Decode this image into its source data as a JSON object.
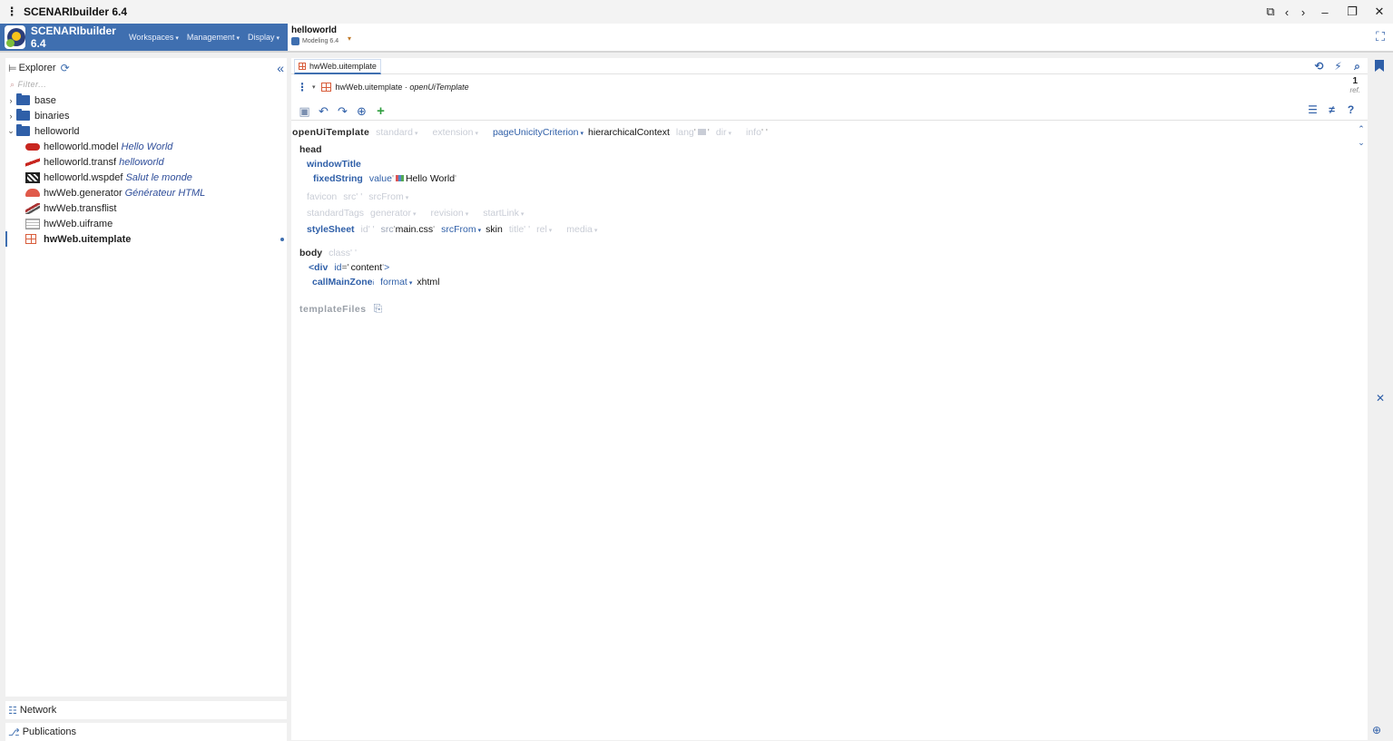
{
  "window": {
    "title": "SCENARIbuilder 6.4",
    "menu_glyph": "⋮"
  },
  "header": {
    "brand": "SCENARIbuilder 6.4",
    "menus": [
      "Workspaces",
      "Management",
      "Display"
    ],
    "workspace": {
      "name": "helloworld",
      "model": "Modeling 6.4"
    }
  },
  "explorer": {
    "title": "Explorer",
    "filter_placeholder": "Filter...",
    "tree": [
      {
        "label": "base",
        "kind": "folder",
        "expanded": false
      },
      {
        "label": "binaries",
        "kind": "folder",
        "expanded": false
      },
      {
        "label": "helloworld",
        "kind": "folder",
        "expanded": true
      },
      {
        "label": "helloworld.model",
        "desc": "Hello World",
        "icon": "model-icon"
      },
      {
        "label": "helloworld.transf",
        "desc": "helloworld",
        "icon": "transf-icon"
      },
      {
        "label": "helloworld.wspdef",
        "desc": "Salut le monde",
        "icon": "wspdef-icon"
      },
      {
        "label": "hwWeb.generator",
        "desc": "Générateur HTML",
        "icon": "generator-icon"
      },
      {
        "label": "hwWeb.transflist",
        "desc": "",
        "icon": "transflist-icon"
      },
      {
        "label": "hwWeb.uiframe",
        "desc": "",
        "icon": "uiframe-icon"
      },
      {
        "label": "hwWeb.uitemplate",
        "desc": "",
        "icon": "uitemplate-icon",
        "selected": true
      }
    ]
  },
  "panels": {
    "network": "Network",
    "publications": "Publications"
  },
  "editor": {
    "tab_label": "hwWeb.uitemplate",
    "breadcrumb_file": "hwWeb.uitemplate",
    "breadcrumb_sep": " · ",
    "breadcrumb_model": "openUiTemplate",
    "ref_count": "1",
    "ref_label": "ref.",
    "content": {
      "root": "openUiTemplate",
      "root_attrs": {
        "standard": "standard",
        "extension": "extension",
        "criterion": "pageUnicityCriterion",
        "criterion_value": "hierarchicalContext",
        "lang": "lang",
        "dir": "dir",
        "info": "info"
      },
      "head": "head",
      "windowTitle": "windowTitle",
      "fixedString": "fixedString",
      "value_label": "value",
      "value_text": "Hello World",
      "favicon": "favicon",
      "src_label": "src",
      "srcFrom_label": "srcFrom",
      "standardTags": "standardTags",
      "generator_label": "generator",
      "revision_label": "revision",
      "startLink_label": "startLink",
      "styleSheet": "styleSheet",
      "id_label": "id",
      "css_value": "main.css",
      "srcFrom_value": "skin",
      "title_label": "title",
      "rel_label": "rel",
      "media_label": "media",
      "body": "body",
      "class_label": "class",
      "div_tag": "<div",
      "div_attr": "id",
      "div_value": "content",
      "div_close": ">",
      "callMainZone": "callMainZone",
      "callMainZone_hint": "i",
      "format_label": "format",
      "format_value": "xhtml",
      "templateFiles": "templateFiles"
    }
  },
  "colors": {
    "brand": "#3f6fb0",
    "accent": "#2f5fa8",
    "muted": "#c9cdd6"
  }
}
